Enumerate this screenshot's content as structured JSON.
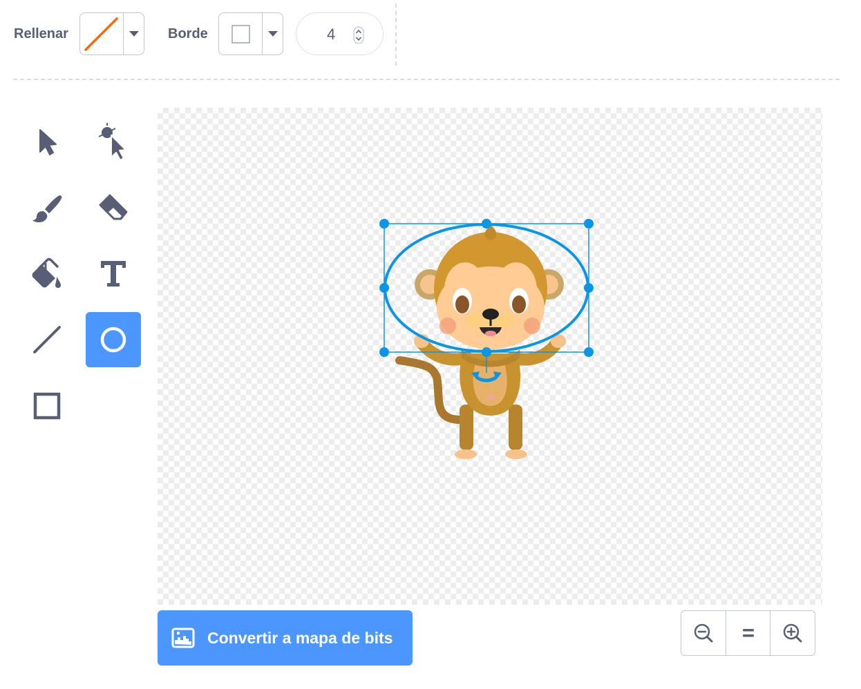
{
  "toolbar": {
    "fill_label": "Rellenar",
    "outline_label": "Borde",
    "stroke_width": "4"
  },
  "tools": [
    {
      "name": "select-tool",
      "icon": "arrow-cursor-icon",
      "selected": false
    },
    {
      "name": "reshape-tool",
      "icon": "reshape-cursor-icon",
      "selected": false
    },
    {
      "name": "brush-tool",
      "icon": "brush-icon",
      "selected": false
    },
    {
      "name": "eraser-tool",
      "icon": "eraser-icon",
      "selected": false
    },
    {
      "name": "fill-tool",
      "icon": "paint-bucket-icon",
      "selected": false
    },
    {
      "name": "text-tool",
      "icon": "text-icon",
      "selected": false
    },
    {
      "name": "line-tool",
      "icon": "line-icon",
      "selected": false
    },
    {
      "name": "circle-tool",
      "icon": "circle-icon",
      "selected": true
    },
    {
      "name": "rectangle-tool",
      "icon": "rectangle-icon",
      "selected": false
    }
  ],
  "bottom": {
    "convert_label": "Convertir a mapa de bits"
  },
  "colors": {
    "accent": "#4c97ff",
    "selection": "#0b95e6",
    "text": "#575e75",
    "fill_none_slash": "#ff6a00"
  }
}
